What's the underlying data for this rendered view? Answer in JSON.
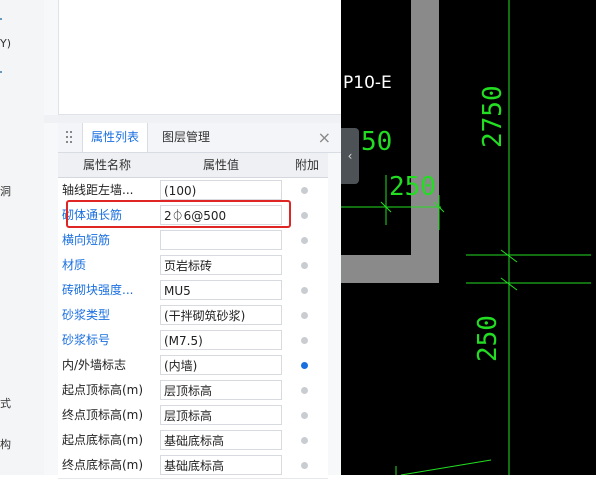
{
  "left_strip": {
    "marks": [
      "Y)",
      "洞",
      "式",
      "构"
    ]
  },
  "panel": {
    "tabs": [
      "属性列表",
      "图层管理"
    ],
    "close_label": "×",
    "columns": [
      "属性名称",
      "属性值",
      "附加"
    ],
    "rows": [
      {
        "name": "轴线距左墙...",
        "value": "(100)",
        "blue": false,
        "checked": false
      },
      {
        "name": "砌体通长筋",
        "value": "2⏀6@500",
        "blue": true,
        "checked": false
      },
      {
        "name": "横向短筋",
        "value": "",
        "blue": true,
        "checked": false
      },
      {
        "name": "材质",
        "value": "页岩标砖",
        "blue": true,
        "checked": false
      },
      {
        "name": "砖砌块强度...",
        "value": "MU5",
        "blue": true,
        "checked": false
      },
      {
        "name": "砂浆类型",
        "value": "(干拌砌筑砂浆)",
        "blue": true,
        "checked": false
      },
      {
        "name": "砂浆标号",
        "value": "(M7.5)",
        "blue": true,
        "checked": false
      },
      {
        "name": "内/外墙标志",
        "value": "(内墙)",
        "blue": false,
        "checked": true
      },
      {
        "name": "起点顶标高(m)",
        "value": "层顶标高",
        "blue": false,
        "checked": false
      },
      {
        "name": "终点顶标高(m)",
        "value": "层顶标高",
        "blue": false,
        "checked": false
      },
      {
        "name": "起点底标高(m)",
        "value": "基础底标高",
        "blue": false,
        "checked": false
      },
      {
        "name": "终点底标高(m)",
        "value": "基础底标高",
        "blue": false,
        "checked": false
      }
    ]
  },
  "canvas": {
    "labels": [
      "P10-E",
      "2750",
      "250",
      "250",
      "50"
    ],
    "colors": {
      "dim": "#22dd22",
      "wall": "#8a8a8a",
      "text": "#ffffff"
    }
  }
}
